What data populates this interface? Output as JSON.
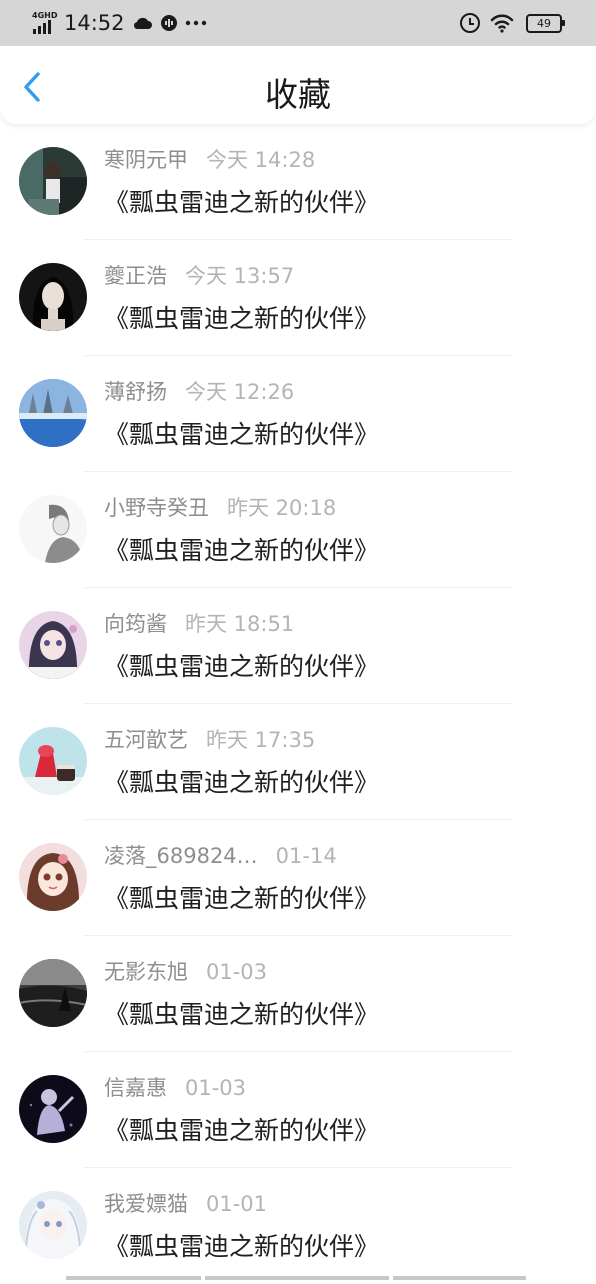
{
  "status_bar": {
    "network": "4GHD",
    "time": "14:52",
    "battery": "49",
    "icons": [
      "cloud-icon",
      "record-icon",
      "more-dots-icon",
      "alarm-icon",
      "wifi-icon",
      "battery-icon"
    ]
  },
  "header": {
    "back_icon": "chevron-left-icon",
    "title": "收藏"
  },
  "colors": {
    "accent": "#2f9cf0",
    "status_bar_bg": "#d6d6d6",
    "username": "#8e8e8e",
    "timestamp": "#b4b4b4",
    "title_text": "#1f1f1f"
  },
  "items": [
    {
      "username": "寒阴元甲",
      "time": "今天 14:28",
      "title": "《瓢虫雷迪之新的伙伴》",
      "avatar": "avatar-girl-dark-room"
    },
    {
      "username": "夔正浩",
      "time": "今天 13:57",
      "title": "《瓢虫雷迪之新的伙伴》",
      "avatar": "avatar-long-hair-girl"
    },
    {
      "username": "薄舒扬",
      "time": "今天 12:26",
      "title": "《瓢虫雷迪之新的伙伴》",
      "avatar": "avatar-snow-landscape"
    },
    {
      "username": "小野寺癸丑",
      "time": "昨天 20:18",
      "title": "《瓢虫雷迪之新的伙伴》",
      "avatar": "avatar-sketch-boy"
    },
    {
      "username": "向筠酱",
      "time": "昨天 18:51",
      "title": "《瓢虫雷迪之新的伙伴》",
      "avatar": "avatar-anime-girl-purple"
    },
    {
      "username": "五河歆艺",
      "time": "昨天 17:35",
      "title": "《瓢虫雷迪之新的伙伴》",
      "avatar": "avatar-red-dessert"
    },
    {
      "username": "凌落_689824…",
      "time": "01-14",
      "title": "《瓢虫雷迪之新的伙伴》",
      "avatar": "avatar-cartoon-girl"
    },
    {
      "username": "无影东旭",
      "time": "01-03",
      "title": "《瓢虫雷迪之新的伙伴》",
      "avatar": "avatar-dark-water"
    },
    {
      "username": "信嘉惠",
      "time": "01-03",
      "title": "《瓢虫雷迪之新的伙伴》",
      "avatar": "avatar-night-figure"
    },
    {
      "username": "我爱嫖猫",
      "time": "01-01",
      "title": "《瓢虫雷迪之新的伙伴》",
      "avatar": "avatar-white-hair-anime"
    }
  ]
}
